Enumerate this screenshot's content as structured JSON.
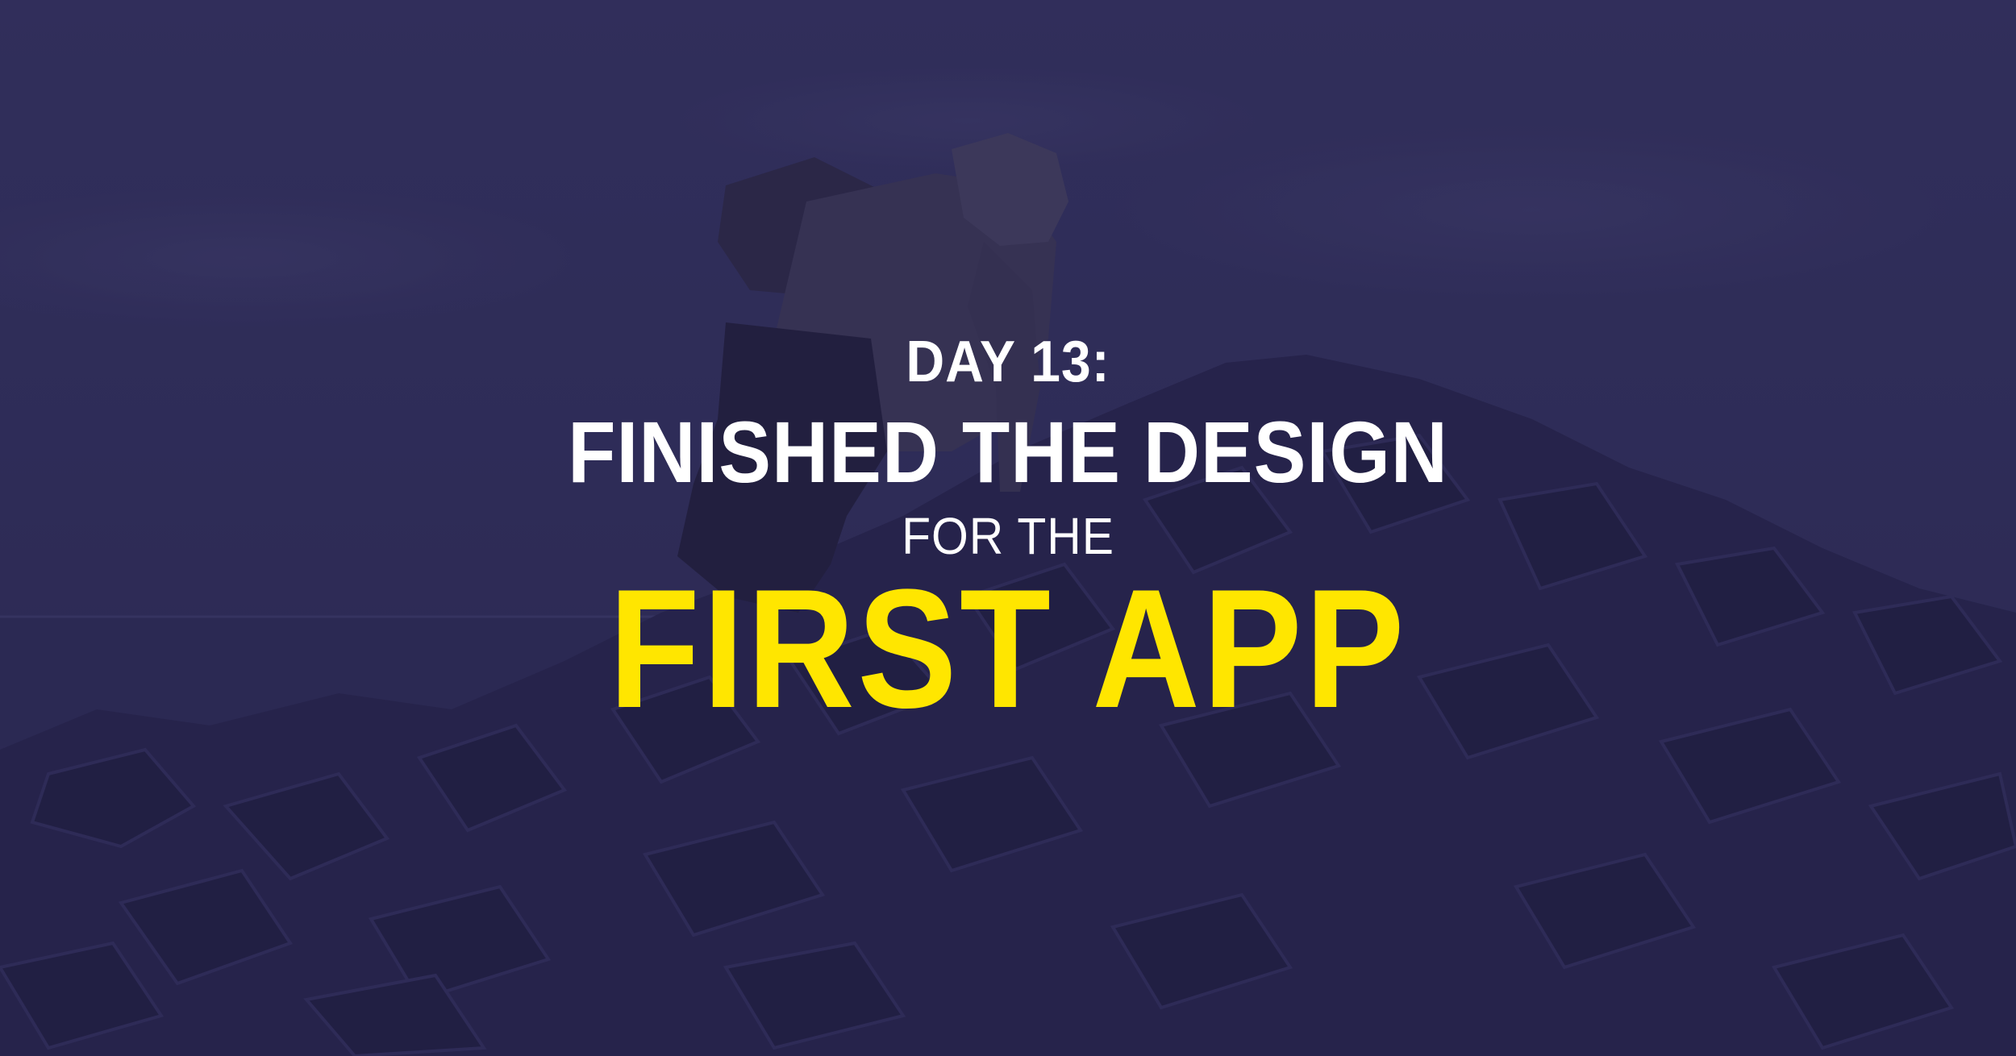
{
  "colors": {
    "overlay": "#2d2b57",
    "sky": "#34325e",
    "rocks": "#1f1d3e",
    "headline_white": "#ffffff",
    "accent_yellow": "#ffe600"
  },
  "headline": {
    "day": "DAY 13:",
    "title": "FINISHED THE DESIGN",
    "connector": "FOR THE",
    "subject": "FIRST APP"
  }
}
